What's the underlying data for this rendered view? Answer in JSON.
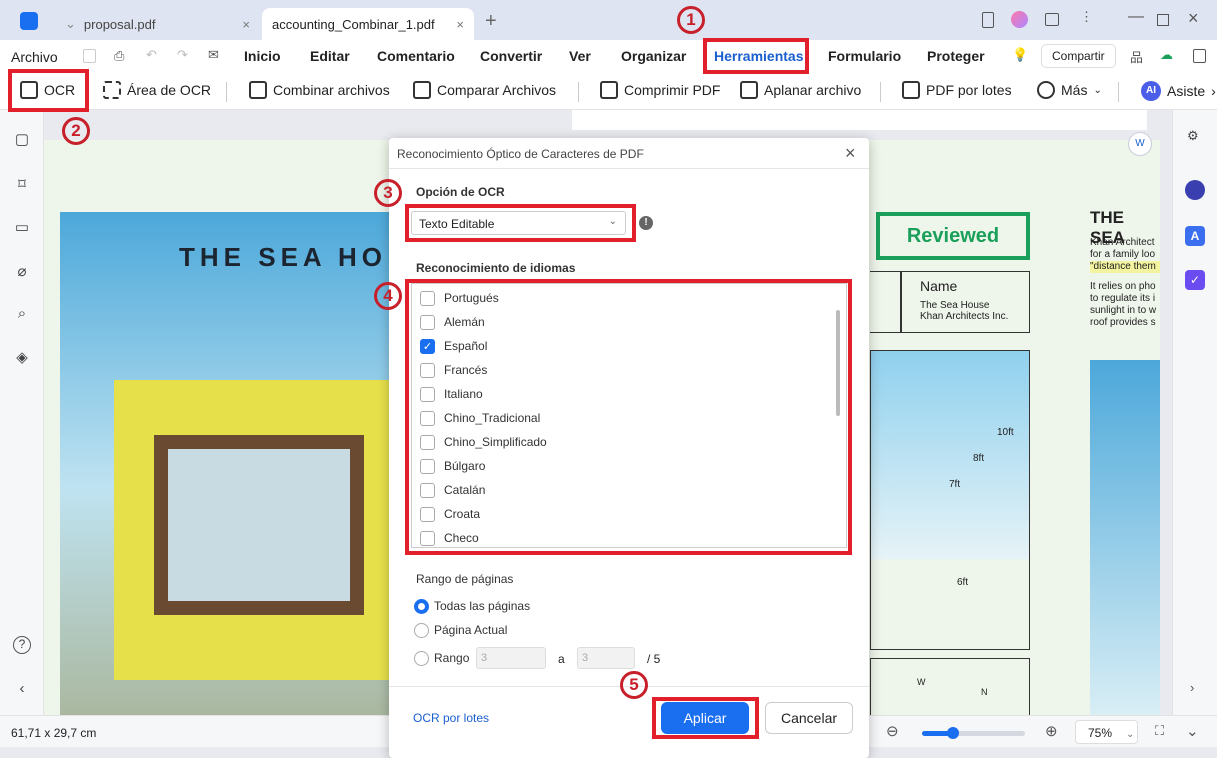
{
  "tabs": [
    {
      "label": "proposal.pdf"
    },
    {
      "label": "accounting_Combinar_1.pdf"
    }
  ],
  "menu": {
    "archivo": "Archivo",
    "items": [
      "Inicio",
      "Editar",
      "Comentario",
      "Convertir",
      "Ver",
      "Organizar",
      "Herramientas",
      "Formulario",
      "Proteger"
    ],
    "share": "Compartir"
  },
  "toolbar": [
    "OCR",
    "Área de OCR",
    "Combinar archivos",
    "Comparar Archivos",
    "Comprimir PDF",
    "Aplanar archivo",
    "PDF por lotes",
    "Más",
    "Asiste"
  ],
  "doc": {
    "title_left": "THE SEA HO",
    "reviewed": "Reviewed",
    "name_label": "Name",
    "name_l1": "The Sea House",
    "name_l2": "Khan Architects Inc.",
    "title_right": "THE SEA",
    "p1": [
      "Khan Architect",
      "for a family loo",
      "\"distance them"
    ],
    "p2": [
      "It relies on pho",
      "to regulate its i",
      "sunlight in to w",
      "roof provides s"
    ],
    "dims": [
      "10ft",
      "8ft",
      "7ft",
      "6ft"
    ],
    "compass": [
      "W",
      "N"
    ]
  },
  "dialog": {
    "title": "Reconocimiento Óptico de Caracteres de PDF",
    "ocr_option_label": "Opción de OCR",
    "ocr_option_value": "Texto Editable",
    "lang_label": "Reconocimiento de idiomas",
    "languages": [
      {
        "name": "Portugués",
        "checked": false
      },
      {
        "name": "Alemán",
        "checked": false
      },
      {
        "name": "Español",
        "checked": true
      },
      {
        "name": "Francés",
        "checked": false
      },
      {
        "name": "Italiano",
        "checked": false
      },
      {
        "name": "Chino_Tradicional",
        "checked": false
      },
      {
        "name": "Chino_Simplificado",
        "checked": false
      },
      {
        "name": "Búlgaro",
        "checked": false
      },
      {
        "name": "Catalán",
        "checked": false
      },
      {
        "name": "Croata",
        "checked": false
      },
      {
        "name": "Checo",
        "checked": false
      }
    ],
    "range_label": "Rango de páginas",
    "range_all": "Todas las páginas",
    "range_current": "Página Actual",
    "range_custom": "Rango",
    "range_from": "3",
    "range_to_label": "a",
    "range_to": "3",
    "range_total": "/ 5",
    "batch_link": "OCR por lotes",
    "apply": "Aplicar",
    "cancel": "Cancelar"
  },
  "status": {
    "size": "61,71 x 29,7 cm",
    "zoom": "75%",
    "zoom_slider_percent": 30
  },
  "annotations": [
    "1",
    "2",
    "3",
    "4",
    "5"
  ],
  "colors": {
    "accent": "#1a6ef0",
    "annotation": "#e2202b",
    "reviewed": "#1aa05a"
  }
}
